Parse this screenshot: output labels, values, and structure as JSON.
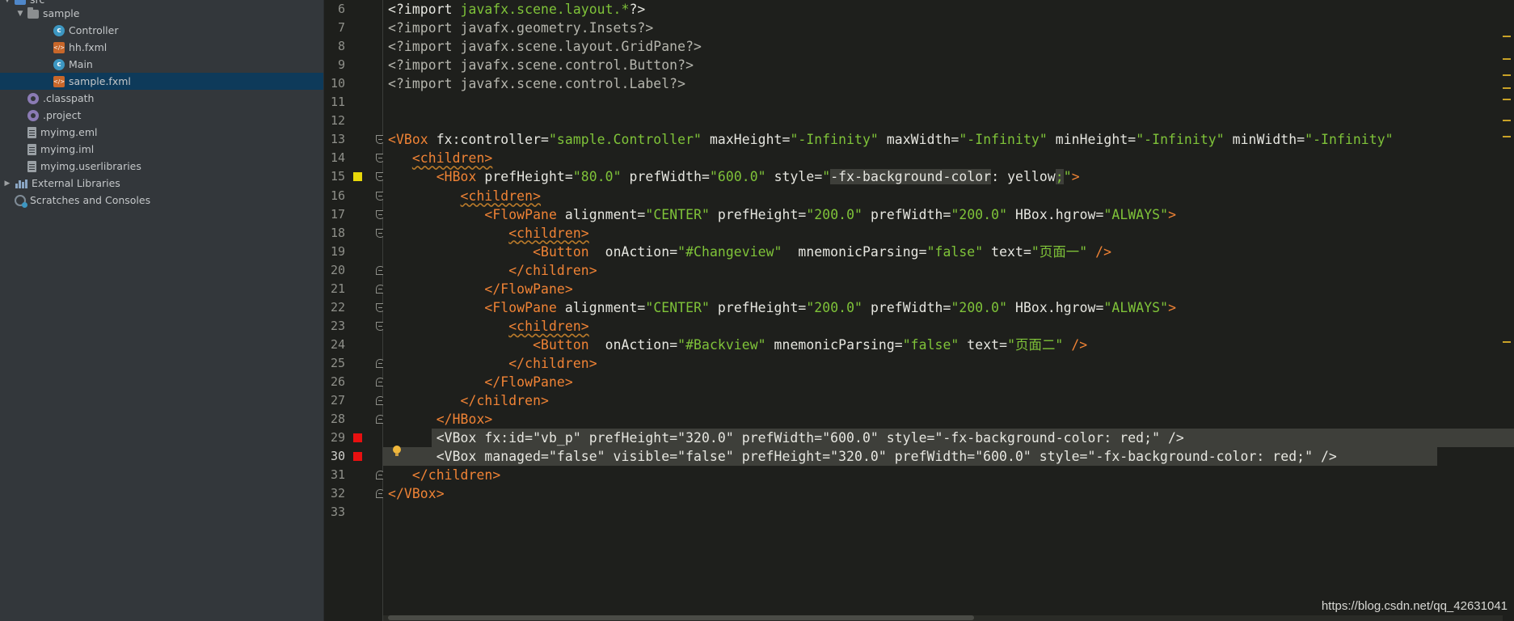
{
  "project_tree": [
    {
      "label": "src",
      "icon": "source-folder-icon",
      "indent": 0,
      "arrow": "down"
    },
    {
      "label": "sample",
      "icon": "folder-icon",
      "indent": 1,
      "arrow": "down"
    },
    {
      "label": "Controller",
      "icon": "class-icon",
      "indent": 2
    },
    {
      "label": "hh.fxml",
      "icon": "fxml-file-icon",
      "indent": 2
    },
    {
      "label": "Main",
      "icon": "class-icon",
      "indent": 2
    },
    {
      "label": "sample.fxml",
      "icon": "fxml-file-icon",
      "indent": 2,
      "selected": true
    },
    {
      "label": ".classpath",
      "icon": "settings-file-icon",
      "indent": 1
    },
    {
      "label": ".project",
      "icon": "settings-file-icon",
      "indent": 1
    },
    {
      "label": "myimg.eml",
      "icon": "text-file-icon",
      "indent": 1
    },
    {
      "label": "myimg.iml",
      "icon": "text-file-icon",
      "indent": 1
    },
    {
      "label": "myimg.userlibraries",
      "icon": "text-file-icon",
      "indent": 1
    },
    {
      "label": "External Libraries",
      "icon": "libraries-icon",
      "indent": 0,
      "arrow": "right"
    },
    {
      "label": "Scratches and Consoles",
      "icon": "scratches-icon",
      "indent": 0
    }
  ],
  "editor": {
    "line_numbers": [
      "6",
      "7",
      "8",
      "9",
      "10",
      "11",
      "12",
      "13",
      "14",
      "15",
      "16",
      "17",
      "18",
      "19",
      "20",
      "21",
      "22",
      "23",
      "24",
      "25",
      "26",
      "27",
      "28",
      "29",
      "30",
      "31",
      "32",
      "33"
    ],
    "lines": [
      {
        "pi_open": "<?import ",
        "pi_path": "javafx.scene.layout.*",
        "pi_close": "?>"
      },
      {
        "text": "<?import javafx.geometry.Insets?>"
      },
      {
        "text": "<?import javafx.scene.layout.GridPane?>"
      },
      {
        "text": "<?import javafx.scene.control.Button?>"
      },
      {
        "text": "<?import javafx.scene.control.Label?>"
      },
      {
        "text": ""
      },
      {
        "text": ""
      },
      {
        "tag": "<VBox",
        "a1": " fx:controller=",
        "v1": "\"sample.Controller\"",
        "a2": " maxHeight=",
        "v2": "\"-Infinity\"",
        "a3": " maxWidth=",
        "v3": "\"-Infinity\"",
        "a4": " minHeight=",
        "v4": "\"-Infinity\"",
        "a5": " minWidth=",
        "v5": "\"-Infinity\""
      },
      {
        "indent": "   ",
        "tag": "<children>"
      },
      {
        "indent": "      ",
        "tag": "<HBox",
        "a1": " prefHeight=",
        "v1": "\"80.0\"",
        "a2": " prefWidth=",
        "v2": "\"600.0\"",
        "a3": " style=",
        "v3a": "\"",
        "v3b": "-fx-background-color",
        "v3c": ": yellow",
        "v3d": ";",
        "v3e": "\"",
        "close": ">"
      },
      {
        "indent": "         ",
        "tag": "<children>"
      },
      {
        "indent": "            ",
        "tag": "<FlowPane",
        "a1": " alignment=",
        "v1": "\"CENTER\"",
        "a2": " prefHeight=",
        "v2": "\"200.0\"",
        "a3": " prefWidth=",
        "v3": "\"200.0\"",
        "a4": " HBox.hgrow=",
        "v4": "\"ALWAYS\"",
        "close": ">"
      },
      {
        "indent": "               ",
        "tag": "<children>"
      },
      {
        "indent": "                  ",
        "tag": "<Button",
        "a1": "  onAction=",
        "v1": "\"#Changeview\"",
        "a2": "  mnemonicParsing=",
        "v2": "\"false\"",
        "a3": " text=",
        "v3": "\"页面一\"",
        "close": " />"
      },
      {
        "indent": "               ",
        "tag": "</children>"
      },
      {
        "indent": "            ",
        "tag": "</FlowPane>"
      },
      {
        "indent": "            ",
        "tag": "<FlowPane",
        "a1": " alignment=",
        "v1": "\"CENTER\"",
        "a2": " prefHeight=",
        "v2": "\"200.0\"",
        "a3": " prefWidth=",
        "v3": "\"200.0\"",
        "a4": " HBox.hgrow=",
        "v4": "\"ALWAYS\"",
        "close": ">"
      },
      {
        "indent": "               ",
        "tag": "<children>"
      },
      {
        "indent": "                  ",
        "tag": "<Button",
        "a1": "  onAction=",
        "v1": "\"#Backview\"",
        "a2": " mnemonicParsing=",
        "v2": "\"false\"",
        "a3": " text=",
        "v3": "\"页面二\"",
        "close": " />"
      },
      {
        "indent": "               ",
        "tag": "</children>"
      },
      {
        "indent": "            ",
        "tag": "</FlowPane>"
      },
      {
        "indent": "         ",
        "tag": "</children>"
      },
      {
        "indent": "      ",
        "tag": "</HBox>"
      },
      {
        "indent": "      ",
        "text": "<VBox fx:id=\"vb_p\" prefHeight=\"320.0\" prefWidth=\"600.0\" style=\"-fx-background-color: red;\" />"
      },
      {
        "indent": "      ",
        "text": "<VBox managed=\"false\" visible=\"false\" prefHeight=\"320.0\" prefWidth=\"600.0\" style=\"-fx-background-color: red;\" />"
      },
      {
        "indent": "   ",
        "tag": "</children>"
      },
      {
        "tag": "</VBox>"
      },
      {
        "text": ""
      }
    ]
  },
  "watermark": "https://blog.csdn.net/qq_42631041",
  "colors": {
    "tag": "#f08335",
    "attribute": "#e6e6e0",
    "value": "#7fc339",
    "background": "#1e1f1c",
    "selection": "#3e3f3a",
    "error_marker": "#e81010",
    "warning_marker": "#e8d80a"
  }
}
